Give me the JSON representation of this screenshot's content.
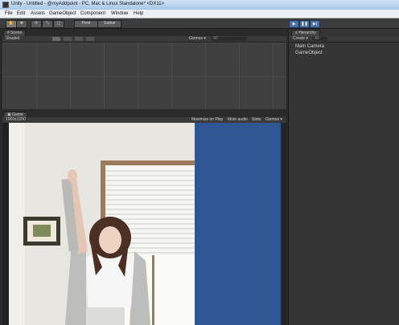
{
  "window": {
    "title": "Unity - Untitled - @myAddpoint - PC, Mac & Linux Standalone* <DX11>"
  },
  "menu": [
    "File",
    "Edit",
    "Assets",
    "GameObject",
    "Component",
    "Window",
    "Help"
  ],
  "toolbar": {
    "pivot_label": "Pivot",
    "global_label": "Global",
    "play_icon": "▶",
    "pause_icon": "❚❚",
    "step_icon": "▶|"
  },
  "scene": {
    "tab_label": "Scene",
    "shading_label": "Shaded",
    "gizmos_label": "Gizmos ▾",
    "search_placeholder": "All"
  },
  "hierarchy": {
    "tab_label": "Hierarchy",
    "create_label": "Create ▾",
    "search_placeholder": "All",
    "items": [
      "Main Camera",
      "GameObject"
    ]
  },
  "game": {
    "tab_label": "Game",
    "resolution_label": "1000x1200",
    "maximize_label": "Maximize on Play",
    "mute_label": "Mute audio",
    "stats_label": "Stats",
    "gizmos_label": "Gizmos ▾"
  },
  "colors": {
    "game_background": "#2e5693",
    "play_button": "#4b6fa0"
  }
}
